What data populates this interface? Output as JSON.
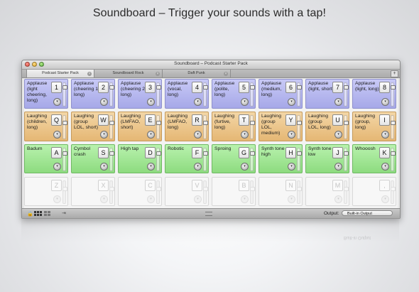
{
  "headline": "Soundboard – Trigger your sounds with a tap!",
  "window": {
    "title": "Soundboard – Podcast Starter Pack",
    "tabs": [
      {
        "label": "Podcast Starter Pack",
        "active": true
      },
      {
        "label": "Soundboard Rock",
        "active": false
      },
      {
        "label": "Daft Punk",
        "active": false
      }
    ],
    "add_tab": "+"
  },
  "rows": [
    {
      "color": "blue",
      "cells": [
        {
          "label": "Applause (light cheering, long)",
          "key": "1"
        },
        {
          "label": "Applause (cheering 1, long)",
          "key": "2"
        },
        {
          "label": "Applause (cheering 2, long)",
          "key": "3"
        },
        {
          "label": "Applause (vocal, long)",
          "key": "4"
        },
        {
          "label": "Applause (polite, long)",
          "key": "5"
        },
        {
          "label": "Applause (medium, long)",
          "key": "6"
        },
        {
          "label": "Applause (light, short)",
          "key": "7"
        },
        {
          "label": "Applause (light, long)",
          "key": "8"
        }
      ]
    },
    {
      "color": "orange",
      "cells": [
        {
          "label": "Laughing (children, long)",
          "key": "Q"
        },
        {
          "label": "Laughing (group LOL, short)",
          "key": "W"
        },
        {
          "label": "Laughing (LMFAO, short)",
          "key": "E"
        },
        {
          "label": "Laughing (LMFAO, long)",
          "key": "R"
        },
        {
          "label": "Laughing (furtive, long)",
          "key": "T"
        },
        {
          "label": "Laughing (group LOL, medium)",
          "key": "Y"
        },
        {
          "label": "Laughing (group LOL, long)",
          "key": "U"
        },
        {
          "label": "Laughing (group, long)",
          "key": "I"
        }
      ]
    },
    {
      "color": "green",
      "cells": [
        {
          "label": "Badum",
          "key": "A"
        },
        {
          "label": "Cymbol crash",
          "key": "S"
        },
        {
          "label": "High tap",
          "key": "D"
        },
        {
          "label": "Robotic",
          "key": "F"
        },
        {
          "label": "Sproing",
          "key": "G"
        },
        {
          "label": "Synth tone high",
          "key": "H"
        },
        {
          "label": "Synth tone low",
          "key": "J"
        },
        {
          "label": "Whooosh",
          "key": "K"
        }
      ]
    },
    {
      "color": "empty",
      "cells": [
        {
          "label": "",
          "key": "Z"
        },
        {
          "label": "",
          "key": "X"
        },
        {
          "label": "",
          "key": "C"
        },
        {
          "label": "",
          "key": "V"
        },
        {
          "label": "",
          "key": "B"
        },
        {
          "label": "",
          "key": "N"
        },
        {
          "label": "",
          "key": "M"
        },
        {
          "label": "",
          "key": ","
        }
      ]
    }
  ],
  "dropdown_glyph": "▾",
  "bottombar": {
    "lock_glyph": "🔒",
    "export_glyph": "⇥",
    "output_label": "Output:",
    "output_value": "Built-in Output"
  },
  "reflection_text": "Built-in Output"
}
